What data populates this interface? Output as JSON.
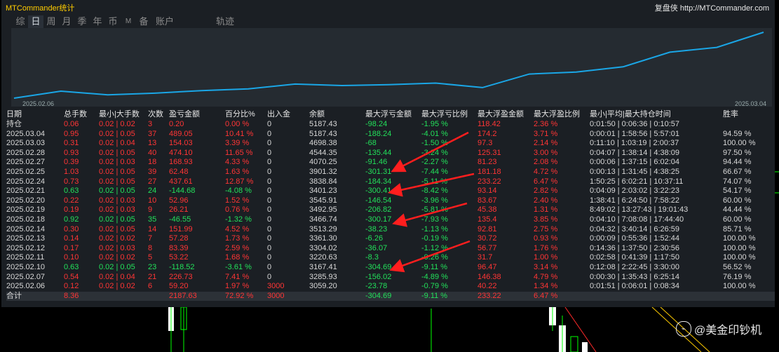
{
  "app": {
    "title": "MTCommander统计",
    "right_title": "复盘侠 http://MTCommander.com"
  },
  "tabs": [
    "综",
    "日",
    "周",
    "月",
    "季",
    "年",
    "币",
    "M",
    "备",
    "账户",
    "轨迹"
  ],
  "active_tab": "日",
  "chart": {
    "start_date": "2025.02.06",
    "end_date": "2025.03.04",
    "line_color": "#1aa6e6",
    "values": [
      3059.2,
      3285.93,
      3167.41,
      3220.63,
      3304.02,
      3361.3,
      3513.29,
      3466.74,
      3492.95,
      3545.91,
      3401.23,
      3838.84,
      3901.32,
      4070.25,
      4544.35,
      4698.38,
      5187.43
    ]
  },
  "headers": {
    "date": "日期",
    "lots": "总手数",
    "minmax": "最小|大手数",
    "count": "次数",
    "pl": "盈亏金额",
    "pct": "百分比%",
    "io": "出入金",
    "bal": "余额",
    "ml": "最大浮亏金额",
    "mlp": "最大浮亏比例",
    "mp": "最大浮盈金额",
    "mpp": "最大浮盈比例",
    "time": "最小|平均|最大持仓时间",
    "win": "胜率"
  },
  "holding": {
    "date": "持仓",
    "lots": "0.06",
    "minmax": "0.02 | 0.02",
    "count": "3",
    "pl": "0.20",
    "pct": "0.00 %",
    "io": "0",
    "bal": "5187.43",
    "ml": "-98.24",
    "mlp": "-1.95 %",
    "mp": "118.42",
    "mpp": "2.36 %",
    "time": "0:01:50 | 0:06:36 | 0:10:57",
    "win": ""
  },
  "rows": [
    {
      "date": "2025.03.04",
      "lots": "0.95",
      "minmax": "0.02 | 0.05",
      "count": "37",
      "pl": "489.05",
      "pct": "10.41 %",
      "io": "0",
      "bal": "5187.43",
      "ml": "-188.24",
      "mlp": "-4.01 %",
      "mp": "174.2",
      "mpp": "3.71 %",
      "time": "0:00:01 | 1:58:56 | 5:57:01",
      "win": "94.59 %",
      "color": "red"
    },
    {
      "date": "2025.03.03",
      "lots": "0.31",
      "minmax": "0.02 | 0.04",
      "count": "13",
      "pl": "154.03",
      "pct": "3.39 %",
      "io": "0",
      "bal": "4698.38",
      "ml": "-68",
      "mlp": "-1.50 %",
      "mp": "97.3",
      "mpp": "2.14 %",
      "time": "0:11:10 | 1:03:19 | 2:00:37",
      "win": "100.00 %",
      "color": "red"
    },
    {
      "date": "2025.02.28",
      "lots": "0.93",
      "minmax": "0.02 | 0.05",
      "count": "40",
      "pl": "474.10",
      "pct": "11.65 %",
      "io": "0",
      "bal": "4544.35",
      "ml": "-135.44",
      "mlp": "-3.24 %",
      "mp": "125.31",
      "mpp": "3.00 %",
      "time": "0:04:07 | 1:38:14 | 4:38:09",
      "win": "97.50 %",
      "color": "red"
    },
    {
      "date": "2025.02.27",
      "lots": "0.39",
      "minmax": "0.02 | 0.03",
      "count": "18",
      "pl": "168.93",
      "pct": "4.33 %",
      "io": "0",
      "bal": "4070.25",
      "ml": "-91.46",
      "mlp": "-2.27 %",
      "mp": "81.23",
      "mpp": "2.08 %",
      "time": "0:00:06 | 1:37:15 | 6:02:04",
      "win": "94.44 %",
      "color": "red"
    },
    {
      "date": "2025.02.25",
      "lots": "1.03",
      "minmax": "0.02 | 0.05",
      "count": "39",
      "pl": "62.48",
      "pct": "1.63 %",
      "io": "0",
      "bal": "3901.32",
      "ml": "-301.31",
      "mlp": "-7.44 %",
      "mp": "181.18",
      "mpp": "4.72 %",
      "time": "0:00:13 | 1:31:45 | 4:38:25",
      "win": "66.67 %",
      "color": "red"
    },
    {
      "date": "2025.02.24",
      "lots": "0.73",
      "minmax": "0.02 | 0.05",
      "count": "27",
      "pl": "437.61",
      "pct": "12.87 %",
      "io": "0",
      "bal": "3838.84",
      "ml": "-184.34",
      "mlp": "-5.11 %",
      "mp": "233.22",
      "mpp": "6.47 %",
      "time": "1:50:25 | 6:02:21 | 10:37:11",
      "win": "74.07 %",
      "color": "red"
    },
    {
      "date": "2025.02.21",
      "lots": "0.63",
      "minmax": "0.02 | 0.05",
      "count": "24",
      "pl": "-144.68",
      "pct": "-4.08 %",
      "io": "0",
      "bal": "3401.23",
      "ml": "-300.41",
      "mlp": "-8.42 %",
      "mp": "93.14",
      "mpp": "2.82 %",
      "time": "0:04:09 | 2:03:02 | 3:22:23",
      "win": "54.17 %",
      "color": "green"
    },
    {
      "date": "2025.02.20",
      "lots": "0.22",
      "minmax": "0.02 | 0.03",
      "count": "10",
      "pl": "52.96",
      "pct": "1.52 %",
      "io": "0",
      "bal": "3545.91",
      "ml": "-146.54",
      "mlp": "-3.96 %",
      "mp": "83.67",
      "mpp": "2.40 %",
      "time": "1:38:41 | 6:24:50 | 7:58:22",
      "win": "60.00 %",
      "color": "red"
    },
    {
      "date": "2025.02.19",
      "lots": "0.19",
      "minmax": "0.02 | 0.03",
      "count": "9",
      "pl": "26.21",
      "pct": "0.76 %",
      "io": "0",
      "bal": "3492.95",
      "ml": "-206.82",
      "mlp": "-5.81 %",
      "mp": "45.38",
      "mpp": "1.31 %",
      "time": "8:49:02 | 13:27:43 | 19:01:43",
      "win": "44.44 %",
      "color": "red"
    },
    {
      "date": "2025.02.18",
      "lots": "0.92",
      "minmax": "0.02 | 0.05",
      "count": "35",
      "pl": "-46.55",
      "pct": "-1.32 %",
      "io": "0",
      "bal": "3466.74",
      "ml": "-300.17",
      "mlp": "-7.93 %",
      "mp": "135.4",
      "mpp": "3.85 %",
      "time": "0:04:10 | 7:08:08 | 17:44:40",
      "win": "60.00 %",
      "color": "green"
    },
    {
      "date": "2025.02.14",
      "lots": "0.30",
      "minmax": "0.02 | 0.05",
      "count": "14",
      "pl": "151.99",
      "pct": "4.52 %",
      "io": "0",
      "bal": "3513.29",
      "ml": "-38.23",
      "mlp": "-1.13 %",
      "mp": "92.81",
      "mpp": "2.75 %",
      "time": "0:04:32 | 3:40:14 | 6:26:59",
      "win": "85.71 %",
      "color": "red"
    },
    {
      "date": "2025.02.13",
      "lots": "0.14",
      "minmax": "0.02 | 0.02",
      "count": "7",
      "pl": "57.28",
      "pct": "1.73 %",
      "io": "0",
      "bal": "3361.30",
      "ml": "-6.26",
      "mlp": "-0.19 %",
      "mp": "30.72",
      "mpp": "0.93 %",
      "time": "0:00:09 | 0:55:36 | 1:52:44",
      "win": "100.00 %",
      "color": "red"
    },
    {
      "date": "2025.02.12",
      "lots": "0.17",
      "minmax": "0.02 | 0.03",
      "count": "8",
      "pl": "83.39",
      "pct": "2.59 %",
      "io": "0",
      "bal": "3304.02",
      "ml": "-36.07",
      "mlp": "-1.12 %",
      "mp": "56.77",
      "mpp": "1.76 %",
      "time": "0:14:36 | 1:37:50 | 2:30:56",
      "win": "100.00 %",
      "color": "red"
    },
    {
      "date": "2025.02.11",
      "lots": "0.10",
      "minmax": "0.02 | 0.02",
      "count": "5",
      "pl": "53.22",
      "pct": "1.68 %",
      "io": "0",
      "bal": "3220.63",
      "ml": "-8.3",
      "mlp": "-0.26 %",
      "mp": "31.7",
      "mpp": "1.00 %",
      "time": "0:02:58 | 0:41:39 | 1:17:50",
      "win": "100.00 %",
      "color": "red"
    },
    {
      "date": "2025.02.10",
      "lots": "0.63",
      "minmax": "0.02 | 0.05",
      "count": "23",
      "pl": "-118.52",
      "pct": "-3.61 %",
      "io": "0",
      "bal": "3167.41",
      "ml": "-304.69",
      "mlp": "-9.11 %",
      "mp": "96.47",
      "mpp": "3.14 %",
      "time": "0:12:08 | 2:22:45 | 3:30:00",
      "win": "56.52 %",
      "color": "green"
    },
    {
      "date": "2025.02.07",
      "lots": "0.54",
      "minmax": "0.02 | 0.04",
      "count": "21",
      "pl": "226.73",
      "pct": "7.41 %",
      "io": "0",
      "bal": "3285.93",
      "ml": "-156.02",
      "mlp": "-4.89 %",
      "mp": "146.38",
      "mpp": "4.79 %",
      "time": "0:00:30 | 1:35:43 | 6:25:14",
      "win": "76.19 %",
      "color": "red"
    },
    {
      "date": "2025.02.06",
      "lots": "0.12",
      "minmax": "0.02 | 0.02",
      "count": "6",
      "pl": "59.20",
      "pct": "1.97 %",
      "io": "3000",
      "bal": "3059.20",
      "ml": "-23.78",
      "mlp": "-0.79 %",
      "mp": "40.22",
      "mpp": "1.34 %",
      "time": "0:01:51 | 0:06:01 | 0:08:34",
      "win": "100.00 %",
      "color": "red"
    }
  ],
  "total": {
    "date": "合计",
    "lots": "8.36",
    "minmax": "",
    "count": "",
    "pl": "2187.63",
    "pct": "72.92 %",
    "io": "3000",
    "bal": "",
    "ml": "-304.69",
    "mlp": "-9.11 %",
    "mp": "233.22",
    "mpp": "6.47 %",
    "time": "",
    "win": ""
  },
  "watermark": "@美金印钞机",
  "colors": {
    "red": "#ff3535",
    "green": "#22e05a",
    "accent": "#ffcc00",
    "line": "#1aa6e6"
  }
}
